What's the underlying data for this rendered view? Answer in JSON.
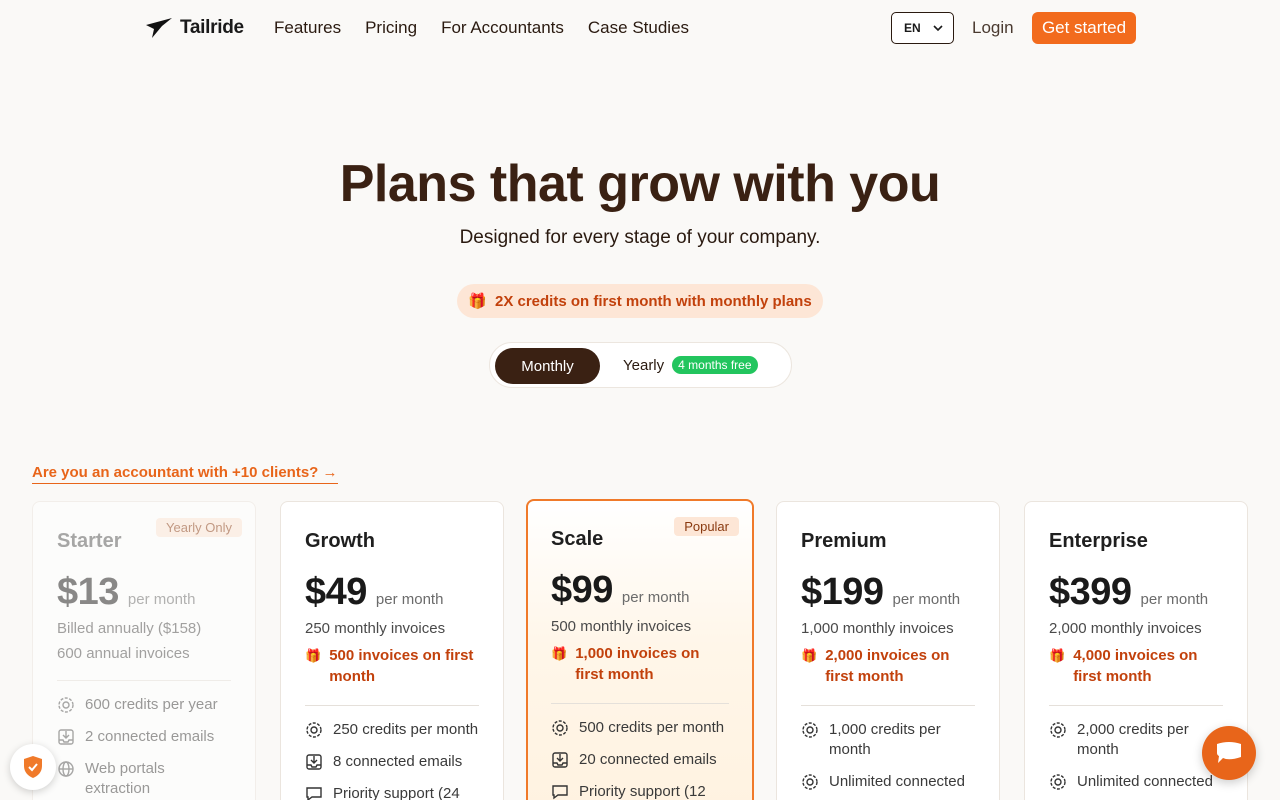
{
  "nav": {
    "brand": "Tailride",
    "links": [
      "Features",
      "Pricing",
      "For Accountants",
      "Case Studies"
    ],
    "language": "EN",
    "login": "Login",
    "cta": "Get started"
  },
  "hero": {
    "title": "Plans that grow with you",
    "subtitle": "Designed for every stage of your company.",
    "promo": "2X credits on first month with monthly plans"
  },
  "billing_toggle": {
    "monthly": "Monthly",
    "yearly": "Yearly",
    "yearly_badge": "4 months free",
    "selected": "Monthly"
  },
  "accountant_link": "Are you an accountant with +10 clients? →",
  "plans": [
    {
      "name": "Starter",
      "badge": "Yearly Only",
      "price": "$13",
      "per": "per month",
      "lines": [
        "Billed annually ($158)",
        "600 annual invoices"
      ],
      "bonus": "",
      "features": [
        "600 credits per year",
        "2 connected emails",
        "Web portals extraction"
      ]
    },
    {
      "name": "Growth",
      "badge": "",
      "price": "$49",
      "per": "per month",
      "lines": [
        "250 monthly invoices"
      ],
      "bonus": "500 invoices on first month",
      "features": [
        "250 credits per month",
        "8 connected emails",
        "Priority support (24"
      ]
    },
    {
      "name": "Scale",
      "badge": "Popular",
      "price": "$99",
      "per": "per month",
      "lines": [
        "500 monthly invoices"
      ],
      "bonus": "1,000 invoices on first month",
      "features": [
        "500 credits per month",
        "20 connected emails",
        "Priority support (12"
      ]
    },
    {
      "name": "Premium",
      "badge": "",
      "price": "$199",
      "per": "per month",
      "lines": [
        "1,000 monthly invoices"
      ],
      "bonus": "2,000 invoices on first month",
      "features": [
        "1,000 credits per month",
        "Unlimited connected"
      ]
    },
    {
      "name": "Enterprise",
      "badge": "",
      "price": "$399",
      "per": "per month",
      "lines": [
        "2,000 monthly invoices"
      ],
      "bonus": "4,000 invoices on first month",
      "features": [
        "2,000 credits per month",
        "Unlimited connected"
      ]
    }
  ],
  "colors": {
    "accent": "#f26b1d",
    "brown": "#3a2113",
    "green": "#22c55e"
  },
  "icons": {
    "gift": "gift-icon",
    "credits": "gear-icon",
    "emails": "inbox-icon",
    "web": "globe-icon",
    "support": "chat-icon"
  }
}
